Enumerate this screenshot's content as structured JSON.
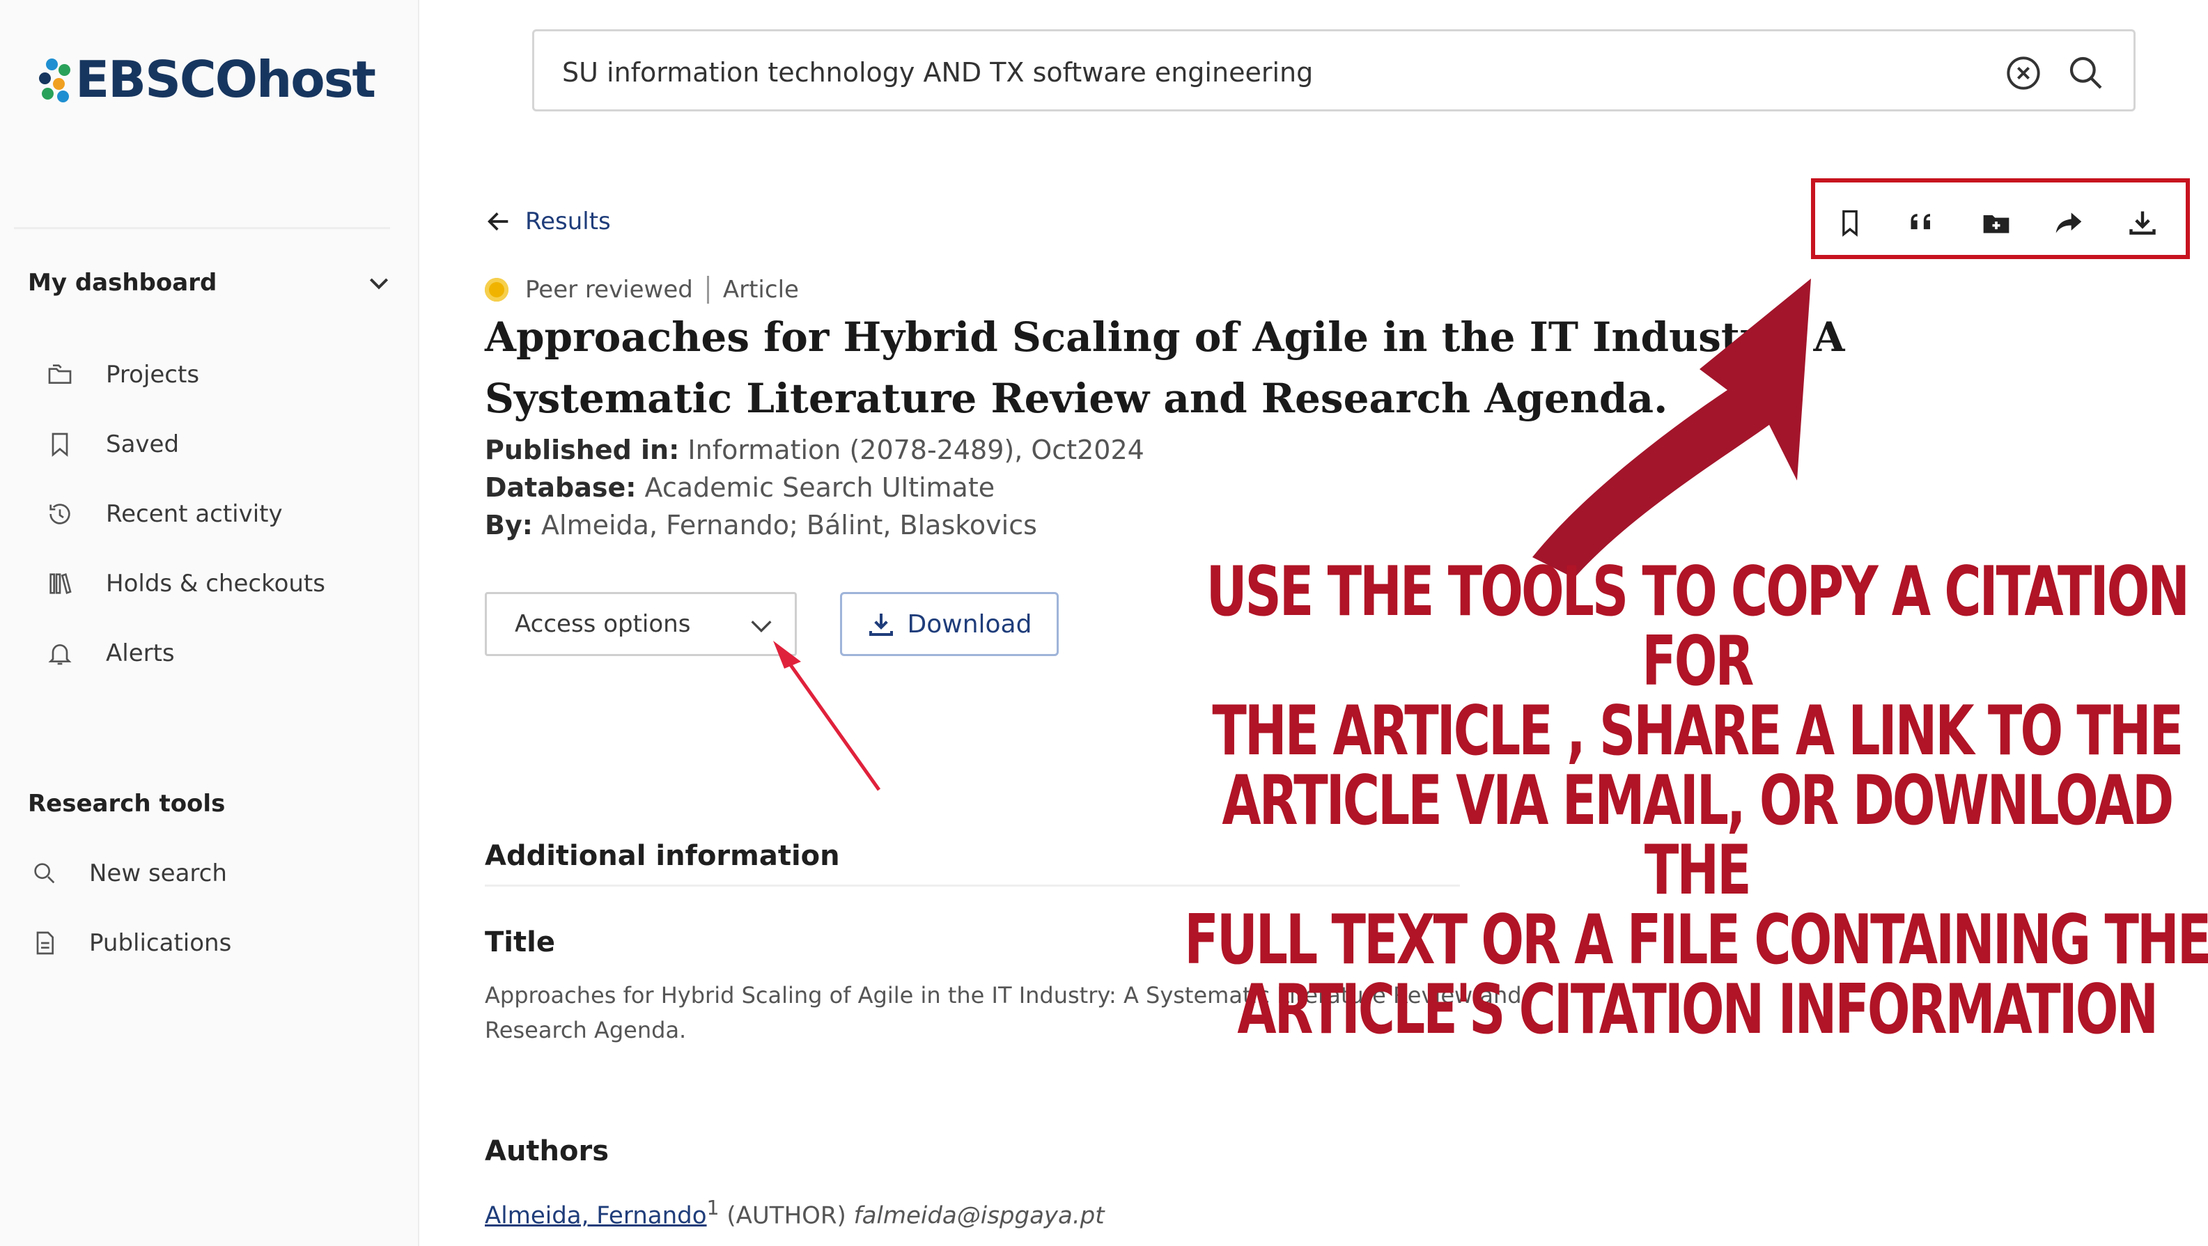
{
  "app": {
    "logo_text": "EBSCOhost"
  },
  "search": {
    "query": "SU information technology AND TX software engineering"
  },
  "sidebar": {
    "dashboard_heading": "My dashboard",
    "dashboard_items": [
      {
        "label": "Projects",
        "icon": "folders-icon"
      },
      {
        "label": "Saved",
        "icon": "bookmark-icon"
      },
      {
        "label": "Recent activity",
        "icon": "history-icon"
      },
      {
        "label": "Holds & checkouts",
        "icon": "books-icon"
      },
      {
        "label": "Alerts",
        "icon": "bell-icon"
      }
    ],
    "tools_heading": "Research tools",
    "tools_items": [
      {
        "label": "New search",
        "icon": "search-icon"
      },
      {
        "label": "Publications",
        "icon": "document-icon"
      }
    ]
  },
  "nav": {
    "back_label": "Results"
  },
  "toolbar": {
    "icons": [
      "bookmark-icon",
      "quote-icon",
      "folder-add-icon",
      "share-icon",
      "download-icon"
    ]
  },
  "article": {
    "peer_reviewed": "Peer reviewed",
    "type": "Article",
    "title": "Approaches for Hybrid Scaling of Agile in the IT Industry: A Systematic Literature Review and Research Agenda.",
    "published_label": "Published in:",
    "published_value": "Information (2078-2489), Oct2024",
    "database_label": "Database:",
    "database_value": "Academic Search Ultimate",
    "by_label": "By:",
    "by_value": "Almeida, Fernando; Bálint, Blaskovics"
  },
  "actions": {
    "access_label": "Access options",
    "download_label": "Download"
  },
  "details": {
    "heading": "Additional information",
    "title_heading": "Title",
    "title_text": "Approaches for Hybrid Scaling of Agile in the IT Industry: A Systematic Literature Review and Research Agenda.",
    "authors_heading": "Authors",
    "author_name": "Almeida, Fernando",
    "author_sup": "1",
    "author_role": "(AUTHOR)",
    "author_email": "falmeida@ispgaya.pt"
  },
  "annotation": {
    "text": "USE THE TOOLS TO COPY A CITATION FOR\nTHE ARTICLE , SHARE A LINK TO THE\nARTICLE VIA EMAIL, OR DOWNLOAD THE\nFULL TEXT OR A FILE CONTAINING THE\nARTICLE'S CITATION INFORMATION",
    "color": "#b01426"
  },
  "colors": {
    "brand_navy": "#17365f",
    "link_blue": "#1f3d7a",
    "highlight_red": "#c7131f",
    "badge_gold": "#f0b400"
  }
}
